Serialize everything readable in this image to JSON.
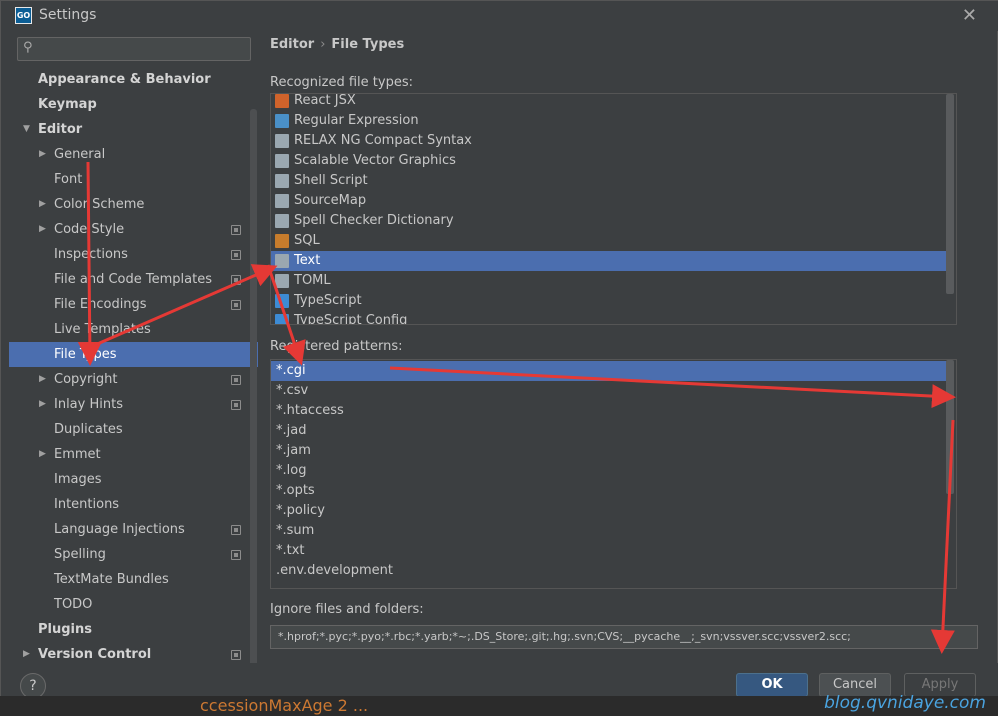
{
  "window": {
    "title": "Settings",
    "app_icon_text": "GO",
    "close_glyph": "✕"
  },
  "sidebar": {
    "search_placeholder": "",
    "search_icon_glyph": "⚲",
    "items": [
      {
        "label": "Appearance & Behavior",
        "level": 0,
        "bold": true,
        "arrow": "",
        "copy": false,
        "selected": false
      },
      {
        "label": "Keymap",
        "level": 0,
        "bold": true,
        "arrow": "",
        "copy": false,
        "selected": false
      },
      {
        "label": "Editor",
        "level": 0,
        "bold": true,
        "arrow": "▼",
        "copy": false,
        "selected": false
      },
      {
        "label": "General",
        "level": 1,
        "bold": false,
        "arrow": "▶",
        "copy": false,
        "selected": false
      },
      {
        "label": "Font",
        "level": 1,
        "bold": false,
        "arrow": "",
        "copy": false,
        "selected": false
      },
      {
        "label": "Color Scheme",
        "level": 1,
        "bold": false,
        "arrow": "▶",
        "copy": false,
        "selected": false
      },
      {
        "label": "Code Style",
        "level": 1,
        "bold": false,
        "arrow": "▶",
        "copy": true,
        "selected": false
      },
      {
        "label": "Inspections",
        "level": 1,
        "bold": false,
        "arrow": "",
        "copy": true,
        "selected": false
      },
      {
        "label": "File and Code Templates",
        "level": 1,
        "bold": false,
        "arrow": "",
        "copy": true,
        "selected": false
      },
      {
        "label": "File Encodings",
        "level": 1,
        "bold": false,
        "arrow": "",
        "copy": true,
        "selected": false
      },
      {
        "label": "Live Templates",
        "level": 1,
        "bold": false,
        "arrow": "",
        "copy": false,
        "selected": false
      },
      {
        "label": "File Types",
        "level": 1,
        "bold": false,
        "arrow": "",
        "copy": false,
        "selected": true
      },
      {
        "label": "Copyright",
        "level": 1,
        "bold": false,
        "arrow": "▶",
        "copy": true,
        "selected": false
      },
      {
        "label": "Inlay Hints",
        "level": 1,
        "bold": false,
        "arrow": "▶",
        "copy": true,
        "selected": false
      },
      {
        "label": "Duplicates",
        "level": 1,
        "bold": false,
        "arrow": "",
        "copy": false,
        "selected": false
      },
      {
        "label": "Emmet",
        "level": 1,
        "bold": false,
        "arrow": "▶",
        "copy": false,
        "selected": false
      },
      {
        "label": "Images",
        "level": 1,
        "bold": false,
        "arrow": "",
        "copy": false,
        "selected": false
      },
      {
        "label": "Intentions",
        "level": 1,
        "bold": false,
        "arrow": "",
        "copy": false,
        "selected": false
      },
      {
        "label": "Language Injections",
        "level": 1,
        "bold": false,
        "arrow": "",
        "copy": true,
        "selected": false
      },
      {
        "label": "Spelling",
        "level": 1,
        "bold": false,
        "arrow": "",
        "copy": true,
        "selected": false
      },
      {
        "label": "TextMate Bundles",
        "level": 1,
        "bold": false,
        "arrow": "",
        "copy": false,
        "selected": false
      },
      {
        "label": "TODO",
        "level": 1,
        "bold": false,
        "arrow": "",
        "copy": false,
        "selected": false
      },
      {
        "label": "Plugins",
        "level": 0,
        "bold": true,
        "arrow": "",
        "copy": false,
        "selected": false
      },
      {
        "label": "Version Control",
        "level": 0,
        "bold": true,
        "arrow": "▶",
        "copy": true,
        "selected": false
      }
    ]
  },
  "breadcrumb": {
    "parent": "Editor",
    "separator": "›",
    "current": "File Types"
  },
  "recognized": {
    "label": "Recognized file types:",
    "items": [
      {
        "name": "React JSX",
        "icon": "jsx-file-icon",
        "color": "#d0632b",
        "selected": false
      },
      {
        "name": "Regular Expression",
        "icon": "regex-file-icon",
        "color": "#4a90c8",
        "selected": false
      },
      {
        "name": "RELAX NG Compact Syntax",
        "icon": "rnc-file-icon",
        "color": "#9aa7b0",
        "selected": false
      },
      {
        "name": "Scalable Vector Graphics",
        "icon": "svg-file-icon",
        "color": "#9aa7b0",
        "selected": false
      },
      {
        "name": "Shell Script",
        "icon": "shell-file-icon",
        "color": "#9aa7b0",
        "selected": false
      },
      {
        "name": "SourceMap",
        "icon": "sourcemap-file-icon",
        "color": "#9aa7b0",
        "selected": false
      },
      {
        "name": "Spell Checker Dictionary",
        "icon": "dictionary-file-icon",
        "color": "#9aa7b0",
        "selected": false
      },
      {
        "name": "SQL",
        "icon": "sql-file-icon",
        "color": "#c77c2c",
        "selected": false
      },
      {
        "name": "Text",
        "icon": "text-file-icon",
        "color": "#9aa7b0",
        "selected": true
      },
      {
        "name": "TOML",
        "icon": "toml-file-icon",
        "color": "#9aa7b0",
        "selected": false
      },
      {
        "name": "TypeScript",
        "icon": "typescript-file-icon",
        "color": "#3d8bd4",
        "selected": false
      },
      {
        "name": "TypeScript Config",
        "icon": "tsconfig-file-icon",
        "color": "#3d8bd4",
        "selected": false
      }
    ]
  },
  "patterns": {
    "label": "Registered patterns:",
    "items": [
      {
        "text": "*.cgi",
        "selected": true
      },
      {
        "text": "*.csv",
        "selected": false
      },
      {
        "text": "*.htaccess",
        "selected": false
      },
      {
        "text": "*.jad",
        "selected": false
      },
      {
        "text": "*.jam",
        "selected": false
      },
      {
        "text": "*.log",
        "selected": false
      },
      {
        "text": "*.opts",
        "selected": false
      },
      {
        "text": "*.policy",
        "selected": false
      },
      {
        "text": "*.sum",
        "selected": false
      },
      {
        "text": "*.txt",
        "selected": false
      },
      {
        "text": ".env.development",
        "selected": false
      }
    ]
  },
  "tools": {
    "add": "+",
    "remove": "−",
    "edit": "✎"
  },
  "ignore": {
    "label": "Ignore files and folders:",
    "value": "*.hprof;*.pyc;*.pyo;*.rbc;*.yarb;*~;.DS_Store;.git;.hg;.svn;CVS;__pycache__;_svn;vssver.scc;vssver2.scc;"
  },
  "buttons": {
    "help": "?",
    "ok": "OK",
    "cancel": "Cancel",
    "apply": "Apply"
  },
  "background": {
    "underlying_text": "ccessionMaxAge          2 ..."
  },
  "watermark": "blog.qvnidaye.com",
  "colors": {
    "selection": "#4b6eaf",
    "annotation_arrow": "#e53935",
    "ok_button": "#365880"
  }
}
